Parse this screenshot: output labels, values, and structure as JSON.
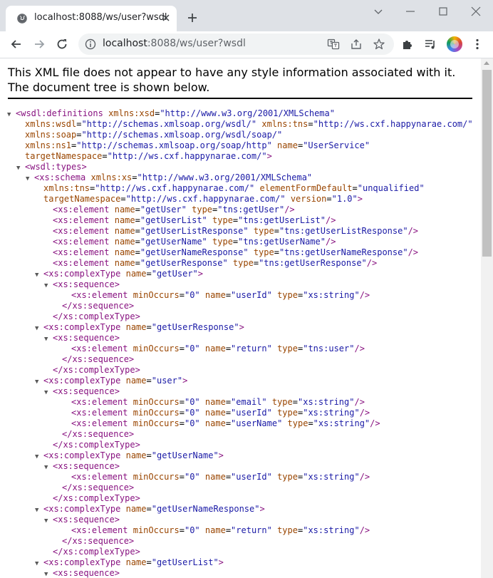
{
  "tab": {
    "title": "localhost:8088/ws/user?wsdl"
  },
  "address": {
    "host": "localhost",
    "rest": ":8088/ws/user?wsdl"
  },
  "page": {
    "notice": "This XML file does not appear to have any style information associated with it. The document tree is shown below."
  },
  "tree_lines": [
    {
      "indent": 0,
      "arrow": true,
      "html": "<span class='tag'>&lt;wsdl:definitions</span> <span class='an'>xmlns:xsd</span>=<span class='av'>\"http://www.w3.org/2001/XMLSchema\"</span>"
    },
    {
      "indent": 1,
      "arrow": false,
      "html": "<span class='an'>xmlns:wsdl</span>=<span class='av'>\"http://schemas.xmlsoap.org/wsdl/\"</span> <span class='an'>xmlns:tns</span>=<span class='av'>\"http://ws.cxf.happynarae.com/\"</span>"
    },
    {
      "indent": 1,
      "arrow": false,
      "html": "<span class='an'>xmlns:soap</span>=<span class='av'>\"http://schemas.xmlsoap.org/wsdl/soap/\"</span>"
    },
    {
      "indent": 1,
      "arrow": false,
      "html": "<span class='an'>xmlns:ns1</span>=<span class='av'>\"http://schemas.xmlsoap.org/soap/http\"</span> <span class='an'>name</span>=<span class='av'>\"UserService\"</span>"
    },
    {
      "indent": 1,
      "arrow": false,
      "html": "<span class='an'>targetNamespace</span>=<span class='av'>\"http://ws.cxf.happynarae.com/\"</span><span class='tag'>&gt;</span>"
    },
    {
      "indent": 1,
      "arrow": true,
      "html": "<span class='tag'>&lt;wsdl:types&gt;</span>"
    },
    {
      "indent": 2,
      "arrow": true,
      "html": "<span class='tag'>&lt;xs:schema</span> <span class='an'>xmlns:xs</span>=<span class='av'>\"http://www.w3.org/2001/XMLSchema\"</span>"
    },
    {
      "indent": 3,
      "arrow": false,
      "html": "<span class='an'>xmlns:tns</span>=<span class='av'>\"http://ws.cxf.happynarae.com/\"</span> <span class='an'>elementFormDefault</span>=<span class='av'>\"unqualified\"</span>"
    },
    {
      "indent": 3,
      "arrow": false,
      "html": "<span class='an'>targetNamespace</span>=<span class='av'>\"http://ws.cxf.happynarae.com/\"</span> <span class='an'>version</span>=<span class='av'>\"1.0\"</span><span class='tag'>&gt;</span>"
    },
    {
      "indent": 4,
      "arrow": false,
      "html": "<span class='tag'>&lt;xs:element</span> <span class='an'>name</span>=<span class='av'>\"getUser\"</span> <span class='an'>type</span>=<span class='av'>\"tns:getUser\"</span><span class='tag'>/&gt;</span>"
    },
    {
      "indent": 4,
      "arrow": false,
      "html": "<span class='tag'>&lt;xs:element</span> <span class='an'>name</span>=<span class='av'>\"getUserList\"</span> <span class='an'>type</span>=<span class='av'>\"tns:getUserList\"</span><span class='tag'>/&gt;</span>"
    },
    {
      "indent": 4,
      "arrow": false,
      "html": "<span class='tag'>&lt;xs:element</span> <span class='an'>name</span>=<span class='av'>\"getUserListResponse\"</span> <span class='an'>type</span>=<span class='av'>\"tns:getUserListResponse\"</span><span class='tag'>/&gt;</span>"
    },
    {
      "indent": 4,
      "arrow": false,
      "html": "<span class='tag'>&lt;xs:element</span> <span class='an'>name</span>=<span class='av'>\"getUserName\"</span> <span class='an'>type</span>=<span class='av'>\"tns:getUserName\"</span><span class='tag'>/&gt;</span>"
    },
    {
      "indent": 4,
      "arrow": false,
      "html": "<span class='tag'>&lt;xs:element</span> <span class='an'>name</span>=<span class='av'>\"getUserNameResponse\"</span> <span class='an'>type</span>=<span class='av'>\"tns:getUserNameResponse\"</span><span class='tag'>/&gt;</span>"
    },
    {
      "indent": 4,
      "arrow": false,
      "html": "<span class='tag'>&lt;xs:element</span> <span class='an'>name</span>=<span class='av'>\"getUserResponse\"</span> <span class='an'>type</span>=<span class='av'>\"tns:getUserResponse\"</span><span class='tag'>/&gt;</span>"
    },
    {
      "indent": 3,
      "arrow": true,
      "html": "<span class='tag'>&lt;xs:complexType</span> <span class='an'>name</span>=<span class='av'>\"getUser\"</span><span class='tag'>&gt;</span>"
    },
    {
      "indent": 4,
      "arrow": true,
      "html": "<span class='tag'>&lt;xs:sequence&gt;</span>"
    },
    {
      "indent": 6,
      "arrow": false,
      "html": "<span class='tag'>&lt;xs:element</span> <span class='an'>minOccurs</span>=<span class='av'>\"0\"</span> <span class='an'>name</span>=<span class='av'>\"userId\"</span> <span class='an'>type</span>=<span class='av'>\"xs:string\"</span><span class='tag'>/&gt;</span>"
    },
    {
      "indent": 5,
      "arrow": false,
      "html": "<span class='tag'>&lt;/xs:sequence&gt;</span>"
    },
    {
      "indent": 4,
      "arrow": false,
      "html": "<span class='tag'>&lt;/xs:complexType&gt;</span>"
    },
    {
      "indent": 3,
      "arrow": true,
      "html": "<span class='tag'>&lt;xs:complexType</span> <span class='an'>name</span>=<span class='av'>\"getUserResponse\"</span><span class='tag'>&gt;</span>"
    },
    {
      "indent": 4,
      "arrow": true,
      "html": "<span class='tag'>&lt;xs:sequence&gt;</span>"
    },
    {
      "indent": 6,
      "arrow": false,
      "html": "<span class='tag'>&lt;xs:element</span> <span class='an'>minOccurs</span>=<span class='av'>\"0\"</span> <span class='an'>name</span>=<span class='av'>\"return\"</span> <span class='an'>type</span>=<span class='av'>\"tns:user\"</span><span class='tag'>/&gt;</span>"
    },
    {
      "indent": 5,
      "arrow": false,
      "html": "<span class='tag'>&lt;/xs:sequence&gt;</span>"
    },
    {
      "indent": 4,
      "arrow": false,
      "html": "<span class='tag'>&lt;/xs:complexType&gt;</span>"
    },
    {
      "indent": 3,
      "arrow": true,
      "html": "<span class='tag'>&lt;xs:complexType</span> <span class='an'>name</span>=<span class='av'>\"user\"</span><span class='tag'>&gt;</span>"
    },
    {
      "indent": 4,
      "arrow": true,
      "html": "<span class='tag'>&lt;xs:sequence&gt;</span>"
    },
    {
      "indent": 6,
      "arrow": false,
      "html": "<span class='tag'>&lt;xs:element</span> <span class='an'>minOccurs</span>=<span class='av'>\"0\"</span> <span class='an'>name</span>=<span class='av'>\"email\"</span> <span class='an'>type</span>=<span class='av'>\"xs:string\"</span><span class='tag'>/&gt;</span>"
    },
    {
      "indent": 6,
      "arrow": false,
      "html": "<span class='tag'>&lt;xs:element</span> <span class='an'>minOccurs</span>=<span class='av'>\"0\"</span> <span class='an'>name</span>=<span class='av'>\"userId\"</span> <span class='an'>type</span>=<span class='av'>\"xs:string\"</span><span class='tag'>/&gt;</span>"
    },
    {
      "indent": 6,
      "arrow": false,
      "html": "<span class='tag'>&lt;xs:element</span> <span class='an'>minOccurs</span>=<span class='av'>\"0\"</span> <span class='an'>name</span>=<span class='av'>\"userName\"</span> <span class='an'>type</span>=<span class='av'>\"xs:string\"</span><span class='tag'>/&gt;</span>"
    },
    {
      "indent": 5,
      "arrow": false,
      "html": "<span class='tag'>&lt;/xs:sequence&gt;</span>"
    },
    {
      "indent": 4,
      "arrow": false,
      "html": "<span class='tag'>&lt;/xs:complexType&gt;</span>"
    },
    {
      "indent": 3,
      "arrow": true,
      "html": "<span class='tag'>&lt;xs:complexType</span> <span class='an'>name</span>=<span class='av'>\"getUserName\"</span><span class='tag'>&gt;</span>"
    },
    {
      "indent": 4,
      "arrow": true,
      "html": "<span class='tag'>&lt;xs:sequence&gt;</span>"
    },
    {
      "indent": 6,
      "arrow": false,
      "html": "<span class='tag'>&lt;xs:element</span> <span class='an'>minOccurs</span>=<span class='av'>\"0\"</span> <span class='an'>name</span>=<span class='av'>\"userId\"</span> <span class='an'>type</span>=<span class='av'>\"xs:string\"</span><span class='tag'>/&gt;</span>"
    },
    {
      "indent": 5,
      "arrow": false,
      "html": "<span class='tag'>&lt;/xs:sequence&gt;</span>"
    },
    {
      "indent": 4,
      "arrow": false,
      "html": "<span class='tag'>&lt;/xs:complexType&gt;</span>"
    },
    {
      "indent": 3,
      "arrow": true,
      "html": "<span class='tag'>&lt;xs:complexType</span> <span class='an'>name</span>=<span class='av'>\"getUserNameResponse\"</span><span class='tag'>&gt;</span>"
    },
    {
      "indent": 4,
      "arrow": true,
      "html": "<span class='tag'>&lt;xs:sequence&gt;</span>"
    },
    {
      "indent": 6,
      "arrow": false,
      "html": "<span class='tag'>&lt;xs:element</span> <span class='an'>minOccurs</span>=<span class='av'>\"0\"</span> <span class='an'>name</span>=<span class='av'>\"return\"</span> <span class='an'>type</span>=<span class='av'>\"xs:string\"</span><span class='tag'>/&gt;</span>"
    },
    {
      "indent": 5,
      "arrow": false,
      "html": "<span class='tag'>&lt;/xs:sequence&gt;</span>"
    },
    {
      "indent": 4,
      "arrow": false,
      "html": "<span class='tag'>&lt;/xs:complexType&gt;</span>"
    },
    {
      "indent": 3,
      "arrow": true,
      "html": "<span class='tag'>&lt;xs:complexType</span> <span class='an'>name</span>=<span class='av'>\"getUserList\"</span><span class='tag'>&gt;</span>"
    },
    {
      "indent": 4,
      "arrow": true,
      "html": "<span class='tag'>&lt;xs:sequence&gt;</span>"
    }
  ]
}
